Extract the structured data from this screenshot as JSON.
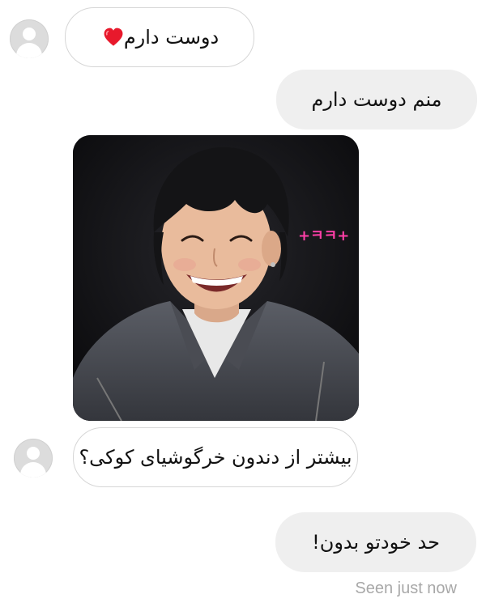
{
  "conversation": {
    "messages": [
      {
        "direction": "incoming",
        "text": "دوست دارم"
      },
      {
        "direction": "outgoing",
        "text": "منم دوست دارم"
      },
      {
        "direction": "outgoing",
        "type": "image",
        "overlay_text": "+ㅋㅋ+"
      },
      {
        "direction": "incoming",
        "text": "بیشتر از دندون خرگوشیای کوکی؟"
      },
      {
        "direction": "outgoing",
        "text": "حد خودتو بدون!"
      }
    ],
    "status": "Seen just now",
    "heart_icon": "heart-icon",
    "colors": {
      "incoming_bubble": "#ffffff",
      "incoming_border": "#d6d6d6",
      "outgoing_bubble": "#efefef",
      "heart": "#e8192c",
      "seen_text": "#a8a8a8",
      "overlay_pink": "#ff3fa8"
    }
  }
}
